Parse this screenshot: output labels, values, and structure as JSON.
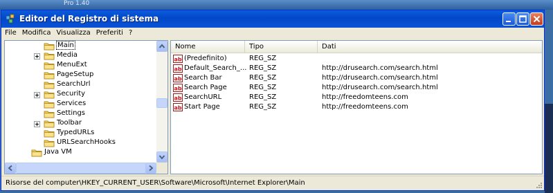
{
  "desktop": {
    "caption": "Pro 1.40"
  },
  "window": {
    "title": "Editor del Registro di sistema",
    "controls": {
      "minimize": "minimize",
      "maximize": "maximize",
      "close": "close"
    }
  },
  "menu": [
    "File",
    "Modifica",
    "Visualizza",
    "Preferiti",
    "?"
  ],
  "tree": {
    "items": [
      {
        "label": "Main",
        "expandable": false,
        "selected": true
      },
      {
        "label": "Media",
        "expandable": true,
        "selected": false
      },
      {
        "label": "MenuExt",
        "expandable": false,
        "selected": false
      },
      {
        "label": "PageSetup",
        "expandable": false,
        "selected": false
      },
      {
        "label": "SearchUrl",
        "expandable": false,
        "selected": false
      },
      {
        "label": "Security",
        "expandable": true,
        "selected": false
      },
      {
        "label": "Services",
        "expandable": false,
        "selected": false
      },
      {
        "label": "Settings",
        "expandable": false,
        "selected": false
      },
      {
        "label": "Toolbar",
        "expandable": true,
        "selected": false
      },
      {
        "label": "TypedURLs",
        "expandable": false,
        "selected": false
      },
      {
        "label": "URLSearchHooks",
        "expandable": false,
        "selected": false
      },
      {
        "label": "Java VM",
        "expandable": false,
        "selected": false
      }
    ]
  },
  "list": {
    "columns": [
      "Nome",
      "Tipo",
      "Dati"
    ],
    "rows": [
      {
        "name": "(Predefinito)",
        "type": "REG_SZ",
        "data": ""
      },
      {
        "name": "Default_Search_...",
        "type": "REG_SZ",
        "data": "http://drusearch.com/search.html"
      },
      {
        "name": "Search Bar",
        "type": "REG_SZ",
        "data": "http://drusearch.com/search.html"
      },
      {
        "name": "Search Page",
        "type": "REG_SZ",
        "data": "http://drusearch.com/search.html"
      },
      {
        "name": "SearchURL",
        "type": "REG_SZ",
        "data": "http://freedomteens.com"
      },
      {
        "name": "Start Page",
        "type": "REG_SZ",
        "data": "http://freedomteens.com"
      }
    ]
  },
  "status": {
    "path": "Risorse del computer\\HKEY_CURRENT_USER\\Software\\Microsoft\\Internet Explorer\\Main"
  },
  "colors": {
    "titlebar": "#0a5ddc",
    "chrome": "#ece9d8",
    "border": "#7f9db9"
  }
}
